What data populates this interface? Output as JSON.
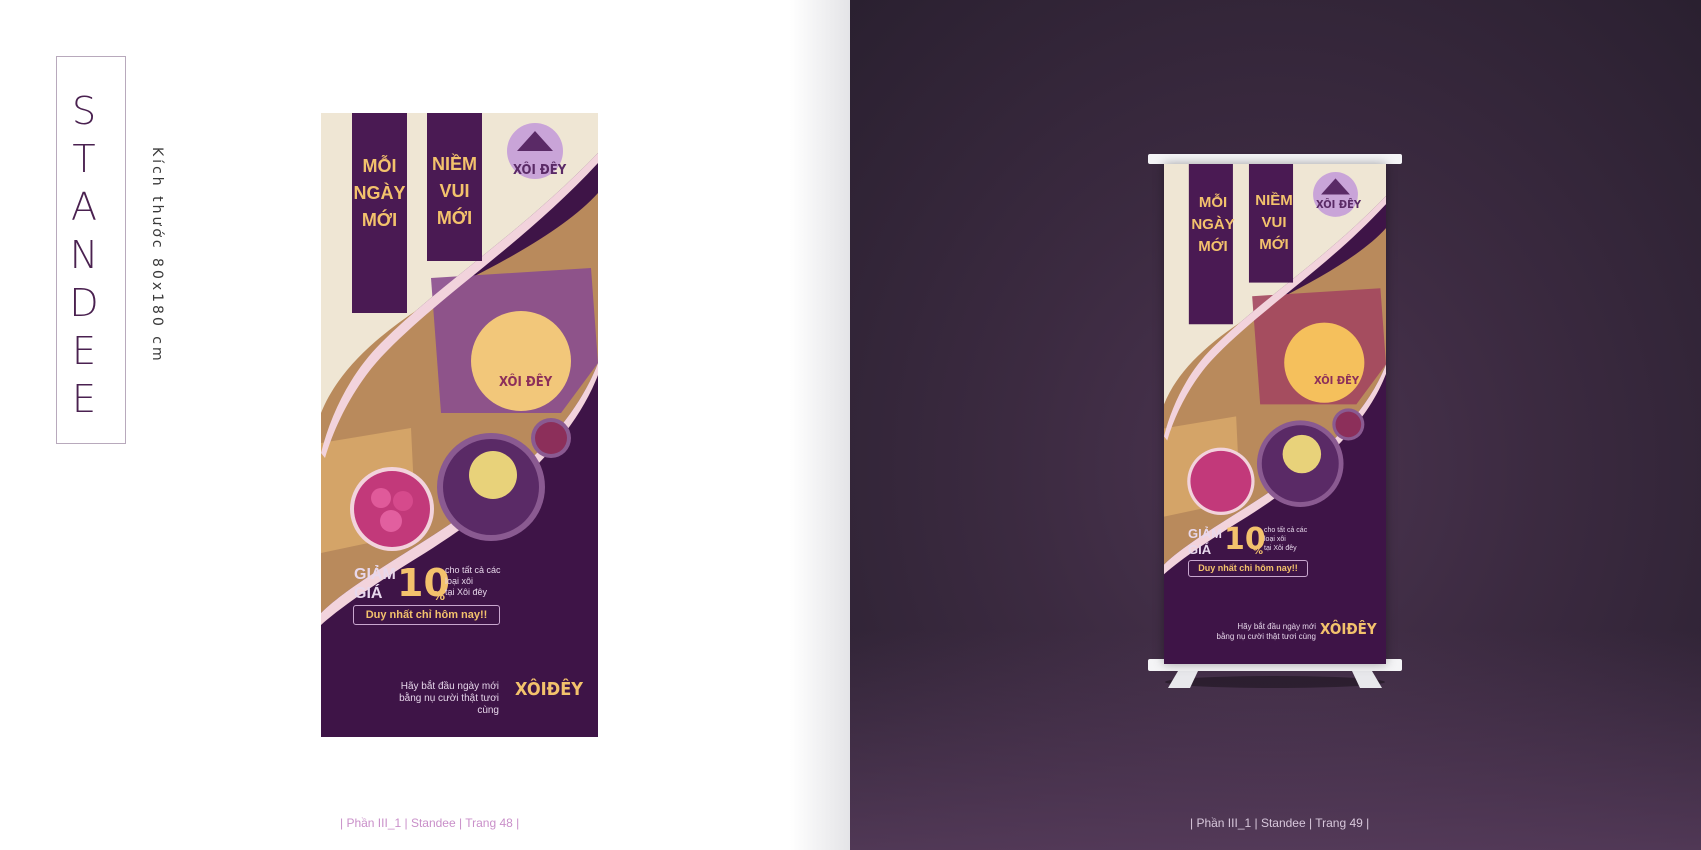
{
  "title": {
    "letters": [
      "S",
      "T",
      "A",
      "N",
      "D",
      "E",
      "E"
    ],
    "size_text": "Kích thước 80x180 cm"
  },
  "standee": {
    "banner_left": [
      "MỖI",
      "NGÀY",
      "MỚI"
    ],
    "banner_right": [
      "NIỀM",
      "VUI",
      "MỚI"
    ],
    "logo_text": "XÔI ĐÊY",
    "discount_label_1": "GIẢM",
    "discount_label_2": "GIÁ",
    "discount_value": "10",
    "discount_unit": "%",
    "discount_desc": [
      "cho tất cả các",
      "loại xôi",
      "tại Xôi đêy"
    ],
    "promo_pill": "Duy nhất chỉ hôm nay!!",
    "tagline": [
      "Hãy bắt đầu ngày mới",
      "bằng nụ cười thật tươi cùng"
    ],
    "tagline_logo": "XÔIĐÊY"
  },
  "footer": {
    "left": "| Phần III_1 | Standee | Trang 48 |",
    "right": "| Phần III_1 | Standee | Trang 49 |"
  },
  "colors": {
    "purple_dark": "#3e1447",
    "purple_band": "#4a1a53",
    "cream": "#efe6d4",
    "gold": "#f3c26c",
    "pink_edge": "#f2d3dc"
  }
}
